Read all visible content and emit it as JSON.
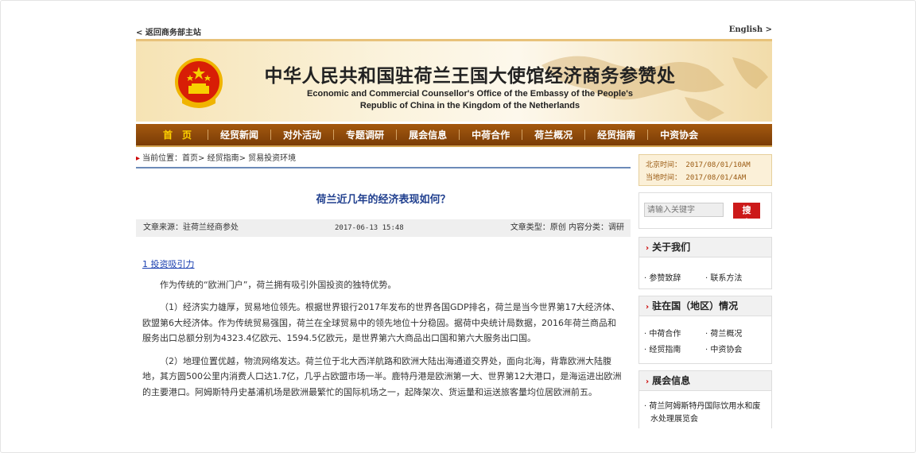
{
  "topbar": {
    "back_label": "< 返回商务部主站",
    "lang_label": "English >"
  },
  "banner": {
    "title_cn": "中华人民共和国驻荷兰王国大使馆经济商务参赞处",
    "title_en_1": "Economic and Commercial Counsellor's Office of the Embassy of the People's",
    "title_en_2": "Republic of China in the Kingdom of the Netherlands"
  },
  "nav": {
    "items": [
      "首　页",
      "经贸新闻",
      "对外活动",
      "专题调研",
      "展会信息",
      "中荷合作",
      "荷兰概况",
      "经贸指南",
      "中资协会"
    ]
  },
  "breadcrumb": {
    "text": "当前位置：首页> 经贸指南> 贸易投资环境"
  },
  "time": {
    "beijing": "北京时间： 2017/08/01/10AM",
    "local": "当地时间： 2017/08/01/4AM"
  },
  "search": {
    "placeholder": "请输入关键字",
    "button_label": "搜 索"
  },
  "panels": {
    "about": {
      "title": "关于我们",
      "items": [
        "参赞致辞",
        "联系方法"
      ]
    },
    "country": {
      "title": "驻在国（地区）情况",
      "items": [
        "中荷合作",
        "荷兰概况",
        "经贸指南",
        "中资协会"
      ]
    },
    "expo": {
      "title": "展会信息",
      "items": [
        "荷兰阿姆斯特丹国际饮用水和废水处理展览会"
      ]
    }
  },
  "article": {
    "title": "荷兰近几年的经济表现如何？",
    "source": "文章来源：驻荷兰经商参处",
    "date": "2017-06-13 15:48",
    "type": "文章类型：原创 内容分类：调研",
    "section_heading": "1 投资吸引力",
    "paragraphs": [
      "作为传统的“欧洲门户”，荷兰拥有吸引外国投资的独特优势。",
      "（1）经济实力雄厚，贸易地位领先。根据世界银行2017年发布的世界各国GDP排名，荷兰是当今世界第17大经济体、欧盟第6大经济体。作为传统贸易强国，荷兰在全球贸易中的领先地位十分稳固。据荷中央统计局数据，2016年荷兰商品和服务出口总额分别为4323.4亿欧元、1594.5亿欧元，是世界第六大商品出口国和第六大服务出口国。",
      "（2）地理位置优越，物流网络发达。荷兰位于北大西洋航路和欧洲大陆出海通道交界处，面向北海，背靠欧洲大陆腹地，其方圆500公里内消费人口达1.7亿，几乎占欧盟市场一半。鹿特丹港是欧洲第一大、世界第12大港口，是海运进出欧洲的主要港口。阿姆斯特丹史基浦机场是欧洲最繁忙的国际机场之一，起降架次、货运量和运送旅客量均位居欧洲前五。"
    ]
  },
  "colors": {
    "nav_bg": "#8a4608",
    "nav_active": "#ffd200",
    "title_blue": "#21408f",
    "search_red": "#cc1a1a"
  }
}
